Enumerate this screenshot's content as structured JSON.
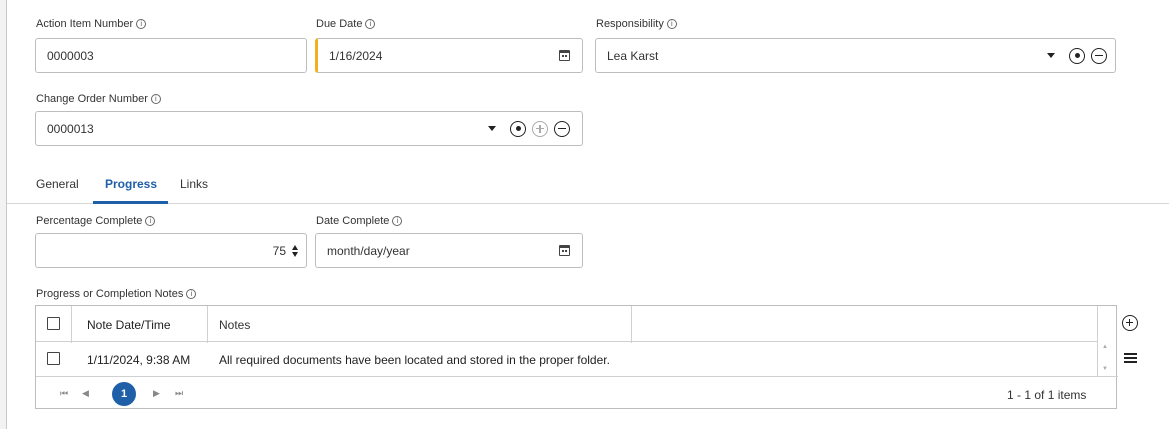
{
  "fields": {
    "action_item_number": {
      "label": "Action Item Number",
      "value": "0000003"
    },
    "due_date": {
      "label": "Due Date",
      "value": "1/16/2024"
    },
    "responsibility": {
      "label": "Responsibility",
      "value": "Lea Karst"
    },
    "change_order_number": {
      "label": "Change Order Number",
      "value": "0000013"
    },
    "percentage_complete": {
      "label": "Percentage Complete",
      "value": "75"
    },
    "date_complete": {
      "label": "Date Complete",
      "value": "month/day/year"
    }
  },
  "info_glyph": "i",
  "tabs": [
    {
      "label": "General",
      "active": false
    },
    {
      "label": "Progress",
      "active": true
    },
    {
      "label": "Links",
      "active": false
    }
  ],
  "notes": {
    "label": "Progress or Completion Notes",
    "columns": [
      "Note Date/Time",
      "Notes"
    ],
    "rows": [
      {
        "datetime": "1/11/2024, 9:38 AM",
        "note": "All required documents have been located and stored in the proper folder."
      }
    ],
    "pager": {
      "first": "⏮",
      "prev": "◀",
      "page": "1",
      "next": "▶",
      "last": "⏭",
      "summary": "1 - 1 of 1 items"
    }
  },
  "colors": {
    "accent": "#1f5fa8",
    "required_marker": "#f2b01e"
  },
  "icons": [
    "calendar-icon",
    "dropdown-caret-icon",
    "select-target-icon",
    "add-circle-icon",
    "remove-circle-icon",
    "spinner-icon",
    "menu-icon"
  ]
}
